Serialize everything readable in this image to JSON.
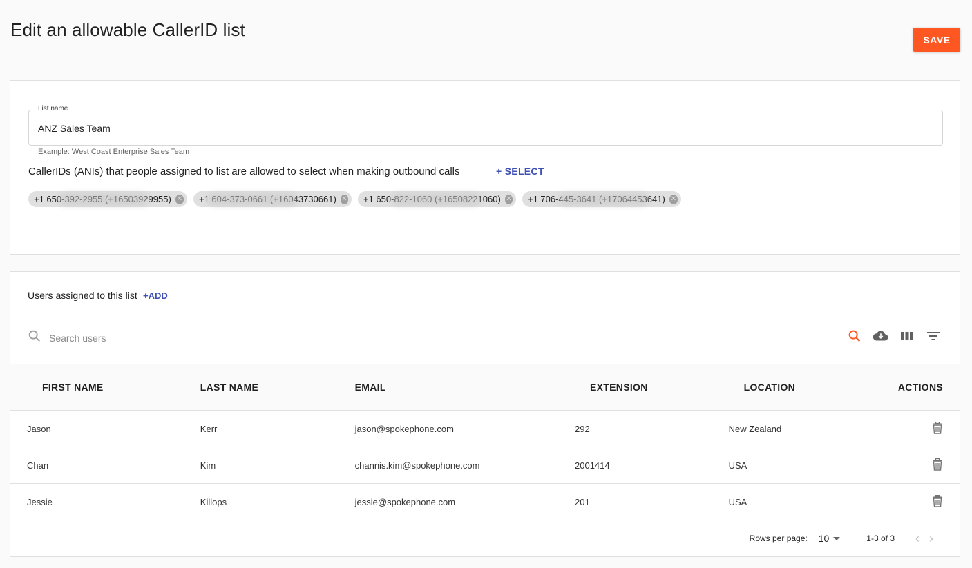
{
  "page": {
    "title": "Edit an allowable CallerID list",
    "save_label": "SAVE",
    "accent": "#ff5722",
    "link_color": "#3f51b5"
  },
  "list_card": {
    "field_label": "List name",
    "field_value": "ANZ Sales Team",
    "helper": "Example: West Coast Enterprise Sales Team",
    "callerid_label": "CallerIDs (ANIs) that people assigned to list are allowed to select when making outbound calls",
    "select_label": "+ SELECT",
    "chips": [
      {
        "label": "+1 650-392-2955 (+16503929955)"
      },
      {
        "label": "+1 604-373-0661 (+16043730661)"
      },
      {
        "label": "+1 650-822-1060 (+16508221060)"
      },
      {
        "label": "+1 706-445-3641 (+17064453641)"
      }
    ]
  },
  "users_card": {
    "title": "Users assigned to this list",
    "add_label": "+ADD",
    "search_placeholder": "Search users",
    "toolbar_icons": [
      "search-icon",
      "download-icon",
      "view-columns-icon",
      "filter-icon"
    ],
    "columns": [
      "FIRST NAME",
      "LAST NAME",
      "EMAIL",
      "EXTENSION",
      "LOCATION",
      "ACTIONS"
    ],
    "rows": [
      {
        "first": "Jason",
        "last": "Kerr",
        "email": "jason@spokephone.com",
        "ext": "292",
        "location": "New Zealand"
      },
      {
        "first": "Chan",
        "last": "Kim",
        "email": "channis.kim@spokephone.com",
        "ext": "2001414",
        "location": "USA"
      },
      {
        "first": "Jessie",
        "last": "Killops",
        "email": "jessie@spokephone.com",
        "ext": "201",
        "location": "USA"
      }
    ],
    "footer": {
      "rows_per_page_label": "Rows per page:",
      "rows_per_page": "10",
      "range": "1-3 of 3"
    }
  }
}
